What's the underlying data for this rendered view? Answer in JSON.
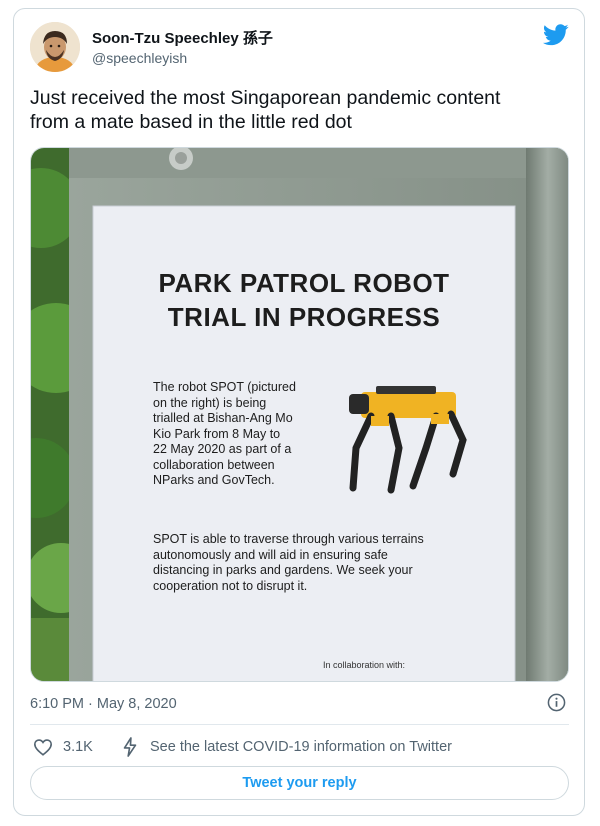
{
  "author": {
    "name": "Soon-Tzu Speechley 孫子",
    "handle": "@speechleyish"
  },
  "tweet": {
    "text_line1": "Just received the most Singaporean pandemic content",
    "text_line2": "from a mate based in the little red dot",
    "timestamp": "6:10 PM · May 8, 2020"
  },
  "photo": {
    "sign_title_line1": "PARK PATROL ROBOT",
    "sign_title_line2": "TRIAL IN PROGRESS",
    "sign_para1": [
      "The robot SPOT (pictured",
      "on the right) is being",
      "trialled at Bishan-Ang Mo",
      "Kio Park from 8 May to",
      "22 May 2020 as part of a",
      "collaboration between",
      "NParks and GovTech."
    ],
    "sign_para2": [
      "SPOT is able to traverse through various terrains",
      "autonomously and will aid in ensuring safe",
      "distancing in parks and gardens. We seek your",
      "cooperation not to disrupt it."
    ],
    "sign_footer": "In collaboration with:"
  },
  "actions": {
    "like_count": "3.1K",
    "covid_info": "See the latest COVID-19 information on Twitter",
    "reply_label": "Tweet your reply"
  },
  "colors": {
    "brand_blue": "#1d9bf0",
    "secondary_text": "#536471",
    "border": "#cfd9de"
  },
  "icons": [
    "twitter-bird-icon",
    "info-icon",
    "heart-icon",
    "lightning-icon"
  ]
}
